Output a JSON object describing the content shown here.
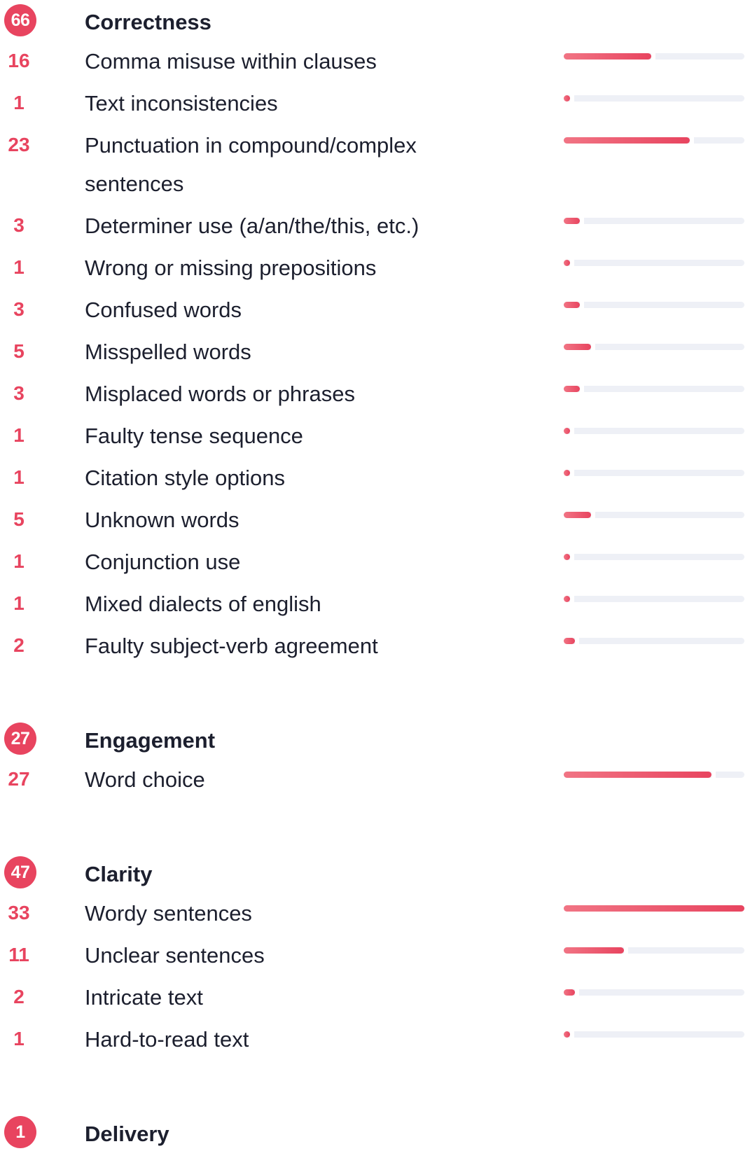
{
  "accent_color": "#e8445f",
  "track_color": "#eef0f6",
  "max_count": 33,
  "sections": [
    {
      "title": "Correctness",
      "count": "66",
      "items": [
        {
          "count": "16",
          "label": "Comma misuse within clauses"
        },
        {
          "count": "1",
          "label": "Text inconsistencies"
        },
        {
          "count": "23",
          "label": "Punctuation in compound/complex sentences"
        },
        {
          "count": "3",
          "label": "Determiner use (a/an/the/this, etc.)"
        },
        {
          "count": "1",
          "label": "Wrong or missing prepositions"
        },
        {
          "count": "3",
          "label": "Confused words"
        },
        {
          "count": "5",
          "label": "Misspelled words"
        },
        {
          "count": "3",
          "label": "Misplaced words or phrases"
        },
        {
          "count": "1",
          "label": "Faulty tense sequence"
        },
        {
          "count": "1",
          "label": "Citation style options"
        },
        {
          "count": "5",
          "label": "Unknown words"
        },
        {
          "count": "1",
          "label": "Conjunction use"
        },
        {
          "count": "1",
          "label": "Mixed dialects of english"
        },
        {
          "count": "2",
          "label": "Faulty subject-verb agreement"
        }
      ]
    },
    {
      "title": "Engagement",
      "count": "27",
      "items": [
        {
          "count": "27",
          "label": "Word choice"
        }
      ]
    },
    {
      "title": "Clarity",
      "count": "47",
      "items": [
        {
          "count": "33",
          "label": "Wordy sentences"
        },
        {
          "count": "11",
          "label": "Unclear sentences"
        },
        {
          "count": "2",
          "label": "Intricate text"
        },
        {
          "count": "1",
          "label": "Hard-to-read text"
        }
      ]
    },
    {
      "title": "Delivery",
      "count": "1",
      "items": []
    }
  ]
}
